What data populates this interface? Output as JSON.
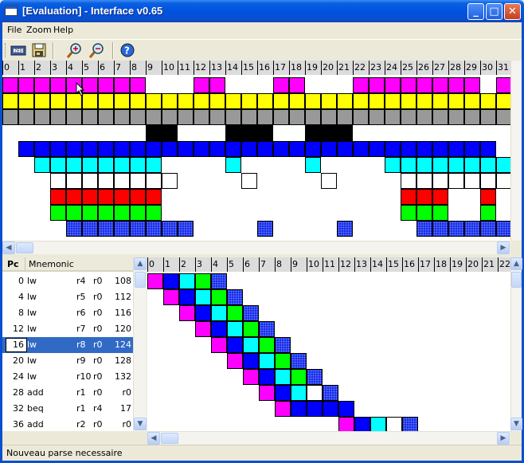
{
  "window": {
    "title": "[Evaluation] - Interface v0.65",
    "buttons": {
      "minimize": "_",
      "maximize": "□",
      "close": "✕"
    }
  },
  "menu": {
    "items": [
      "File",
      "Zoom",
      "Help"
    ]
  },
  "toolbar": {
    "tools": [
      "open-icon",
      "save-icon",
      "zoom-in-icon",
      "zoom-out-icon",
      "help-icon"
    ]
  },
  "colors": {
    "magenta": "#ff00ff",
    "yellow": "#ffff00",
    "gray": "#999999",
    "black": "#000000",
    "blue": "#0000ff",
    "cyan": "#00ffff",
    "white": "#ffffff",
    "red": "#ff0000",
    "green": "#00ff00",
    "dotted_blue": "#1b2ee8",
    "selection": "#316ac5"
  },
  "top_ruler": [
    "0",
    "1",
    "2",
    "3",
    "4",
    "5",
    "6",
    "7",
    "8",
    "9",
    "10",
    "11",
    "12",
    "13",
    "14",
    "15",
    "16",
    "17",
    "18",
    "19",
    "20",
    "21",
    "22",
    "23",
    "24",
    "25",
    "26",
    "27",
    "28",
    "29",
    "30",
    "31"
  ],
  "top_rows": [
    {
      "color": "magenta",
      "cells": [
        0,
        1,
        2,
        3,
        4,
        5,
        6,
        7,
        8,
        12,
        13,
        17,
        18,
        22,
        23,
        24,
        25,
        26,
        27,
        28,
        29,
        31
      ]
    },
    {
      "color": "yellow",
      "cells": [
        0,
        1,
        2,
        3,
        4,
        5,
        6,
        7,
        8,
        9,
        10,
        11,
        12,
        13,
        14,
        15,
        16,
        17,
        18,
        19,
        20,
        21,
        22,
        23,
        24,
        25,
        26,
        27,
        28,
        29,
        30,
        31
      ]
    },
    {
      "color": "gray",
      "cells": [
        0,
        1,
        2,
        3,
        4,
        5,
        6,
        7,
        8,
        9,
        10,
        11,
        12,
        13,
        14,
        15,
        16,
        17,
        18,
        19,
        20,
        21,
        22,
        23,
        24,
        25,
        26,
        27,
        28,
        29,
        30,
        31
      ]
    },
    {
      "color": "black",
      "cells": [
        9,
        10,
        14,
        15,
        16,
        19,
        20,
        21
      ]
    },
    {
      "color": "blue",
      "cells": [
        1,
        2,
        3,
        4,
        5,
        6,
        7,
        8,
        9,
        10,
        11,
        12,
        13,
        14,
        15,
        16,
        17,
        18,
        19,
        20,
        21,
        22,
        23,
        24,
        25,
        26,
        27,
        28,
        29,
        30
      ]
    },
    {
      "color": "cyan",
      "cells": [
        2,
        3,
        4,
        5,
        6,
        7,
        8,
        9,
        14,
        19,
        24,
        25,
        26,
        27,
        28,
        29,
        30,
        31
      ]
    },
    {
      "color": "white",
      "cells": [
        3,
        4,
        5,
        6,
        7,
        8,
        9,
        10,
        15,
        20,
        25,
        26,
        27,
        28,
        29,
        30,
        31
      ]
    },
    {
      "color": "red",
      "cells": [
        3,
        4,
        5,
        6,
        7,
        8,
        9,
        25,
        26,
        27,
        30
      ]
    },
    {
      "color": "green",
      "cells": [
        3,
        4,
        5,
        6,
        7,
        8,
        9,
        25,
        26,
        27,
        30
      ]
    },
    {
      "color": "dotted_blue",
      "cells": [
        4,
        5,
        6,
        7,
        8,
        9,
        10,
        11,
        16,
        21,
        26,
        27,
        28,
        29,
        30,
        31
      ]
    }
  ],
  "list": {
    "headers": [
      "Pc",
      "Mnemonic"
    ],
    "rows": [
      {
        "pc": "0",
        "op": "lw",
        "a": "r4",
        "b": "r0",
        "c": "108"
      },
      {
        "pc": "4",
        "op": "lw",
        "a": "r5",
        "b": "r0",
        "c": "112"
      },
      {
        "pc": "8",
        "op": "lw",
        "a": "r6",
        "b": "r0",
        "c": "116"
      },
      {
        "pc": "12",
        "op": "lw",
        "a": "r7",
        "b": "r0",
        "c": "120"
      },
      {
        "pc": "16",
        "op": "lw",
        "a": "r8",
        "b": "r0",
        "c": "124",
        "selected": true
      },
      {
        "pc": "20",
        "op": "lw",
        "a": "r9",
        "b": "r0",
        "c": "128"
      },
      {
        "pc": "24",
        "op": "lw",
        "a": "r10",
        "b": "r0",
        "c": "132"
      },
      {
        "pc": "28",
        "op": "add",
        "a": "r1",
        "b": "r0",
        "c": "r0"
      },
      {
        "pc": "32",
        "op": "beq",
        "a": "r1",
        "b": "r4",
        "c": "17"
      },
      {
        "pc": "36",
        "op": "add",
        "a": "r2",
        "b": "r0",
        "c": "r0"
      }
    ]
  },
  "bottom_ruler": [
    "0",
    "1",
    "2",
    "3",
    "4",
    "5",
    "6",
    "7",
    "8",
    "9",
    "10",
    "11",
    "12",
    "13",
    "14",
    "15",
    "16",
    "17",
    "18",
    "19",
    "20",
    "21",
    "22"
  ],
  "pipeline_stages": [
    "magenta",
    "blue",
    "cyan",
    "green",
    "dotted_blue"
  ],
  "pipeline_rows": [
    {
      "start": 0,
      "stages": [
        "magenta",
        "blue",
        "cyan",
        "green",
        "dotted_blue"
      ]
    },
    {
      "start": 1,
      "stages": [
        "magenta",
        "blue",
        "cyan",
        "green",
        "dotted_blue"
      ]
    },
    {
      "start": 2,
      "stages": [
        "magenta",
        "blue",
        "cyan",
        "green",
        "dotted_blue"
      ]
    },
    {
      "start": 3,
      "stages": [
        "magenta",
        "blue",
        "cyan",
        "green",
        "dotted_blue"
      ]
    },
    {
      "start": 4,
      "stages": [
        "magenta",
        "blue",
        "cyan",
        "green",
        "dotted_blue"
      ]
    },
    {
      "start": 5,
      "stages": [
        "magenta",
        "blue",
        "cyan",
        "green",
        "dotted_blue"
      ]
    },
    {
      "start": 6,
      "stages": [
        "magenta",
        "blue",
        "cyan",
        "green",
        "dotted_blue"
      ]
    },
    {
      "start": 7,
      "stages": [
        "magenta",
        "blue",
        "cyan",
        "white",
        "dotted_blue"
      ]
    },
    {
      "start": 8,
      "stages": [
        "magenta",
        "blue",
        "blue",
        "blue",
        "blue"
      ]
    },
    {
      "start": 12,
      "stages": [
        "magenta",
        "blue",
        "cyan",
        "white",
        "dotted_blue"
      ]
    }
  ],
  "status": {
    "text": "Nouveau parse necessaire"
  }
}
